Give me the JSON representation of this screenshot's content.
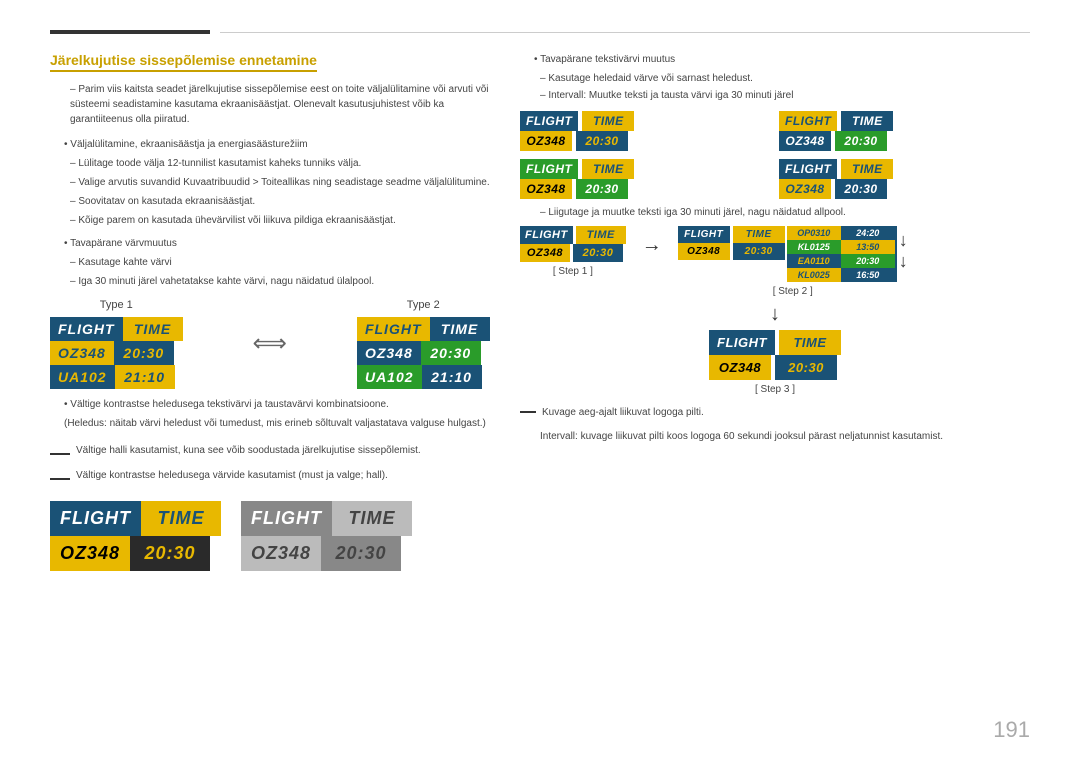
{
  "page": {
    "number": "191"
  },
  "top_rules": {
    "dark_rule": "",
    "light_rule": ""
  },
  "left": {
    "heading": "Järelkujutise sissepõlemise ennetamine",
    "intro_dash": "Parim viis kaitsta seadet järelkujutise sissepõlemise eest on toite väljalülitamine või arvuti või süsteemi seadistamine kasutama ekraanisäästjat. Olenevalt kasutusjuhistest võib ka garantiiteenus olla piiratud.",
    "bullets": [
      "Väljalülitamine, ekraanisäästja ja energiasäästurežiim",
      "Tavapärane värvmuutus"
    ],
    "sub_bullets_1": [
      "Lülitage toode välja 12-tunnilist kasutamist kaheks tunniks välja.",
      "Valige arvutis suvandid Kuvaatribuudid > Toiteallikas ning seadistage seadme väljalülitumine.",
      "Soovitatav on kasutada ekraanisäästjat.",
      "Kõige parem on kasutada ühevärvilist või liikuva pildiga ekraanisäästjat."
    ],
    "sub_bullets_2": [
      "Kasutage kahte värvi",
      "Iga 30 minuti järel vahetatakse kahte värvi, nagu näidatud ülalpool."
    ],
    "type_labels": [
      "Type 1",
      "Type 2"
    ],
    "type1": {
      "header": [
        "FLIGHT",
        "TIME"
      ],
      "row1": [
        "OZ348",
        "20:30"
      ],
      "row2": [
        "UA102",
        "21:10"
      ]
    },
    "type2": {
      "header": [
        "FLIGHT",
        "TIME"
      ],
      "row1": [
        "OZ348",
        "20:30"
      ],
      "row2": [
        "UA102",
        "21:10"
      ]
    },
    "contrast_bullets": [
      "Vältige kontrastse heledusega tekstivärvi ja taustavärvi kombinatsioone.",
      "(Heledus: näitab värvi heledust või tumedust, mis erineb sõltuvalt valjastatava valguse hulgast.)"
    ],
    "warning_lines": [
      "Vältige halli kasutamist, kuna see võib soodustada järelkujutise sissepõlemist.",
      "Vältige kontrastse heledusega värvide kasutamist (must ja valge; hall)."
    ],
    "bottom_widget1": {
      "header": [
        "FLIGHT",
        "TIME"
      ],
      "row1": [
        "OZ348",
        "20:30"
      ],
      "bg": "black"
    },
    "bottom_widget2": {
      "header": [
        "FLIGHT",
        "TIME"
      ],
      "row1": [
        "OZ348",
        "20:30"
      ],
      "bg": "gray"
    }
  },
  "right": {
    "bullet1": "Tavapärane tekstivärvi muutus",
    "sub1": [
      "Kasutage heledaid värve või sarnast heledust.",
      "Intervall: Muutke teksti ja tausta värvi iga 30 minuti järel"
    ],
    "grid_widgets": [
      {
        "variant": "v1",
        "header": [
          "FLIGHT",
          "TIME"
        ],
        "row1": [
          "OZ348",
          "20:30"
        ]
      },
      {
        "variant": "v2",
        "header": [
          "FLIGHT",
          "TIME"
        ],
        "row1": [
          "OZ348",
          "20:30"
        ]
      },
      {
        "variant": "v3",
        "header": [
          "FLIGHT",
          "TIME"
        ],
        "row1": [
          "OZ348",
          "20:30"
        ]
      },
      {
        "variant": "v4",
        "header": [
          "FLIGHT",
          "TIME"
        ],
        "row1": [
          "OZ348",
          "20:30"
        ]
      }
    ],
    "steps_dash": "Liigutage ja muutke teksti iga 30 minuti järel, nagu näidatud allpool.",
    "step1_label": "[ Step 1 ]",
    "step2_label": "[ Step 2 ]",
    "step3_label": "[ Step 3 ]",
    "step1": {
      "header": [
        "FLIGHT",
        "TIME"
      ],
      "row1": [
        "OZ348",
        "20:30"
      ]
    },
    "step2": {
      "lines": [
        [
          "OP0310",
          "24:20"
        ],
        [
          "KL0125",
          "13:50"
        ],
        [
          "EA0110",
          "20:30"
        ],
        [
          "KL0025",
          "16:50"
        ]
      ]
    },
    "step3": {
      "header": [
        "FLIGHT",
        "TIME"
      ],
      "row1": [
        "OZ348",
        "20:30"
      ]
    },
    "footer_dash": "Kuvage aeg-ajalt liikuvat logoga pilti.",
    "footer_text": "Intervall: kuvage liikuvat pilti koos logoga 60 sekundi jooksul pärast neljatunnist kasutamist."
  }
}
